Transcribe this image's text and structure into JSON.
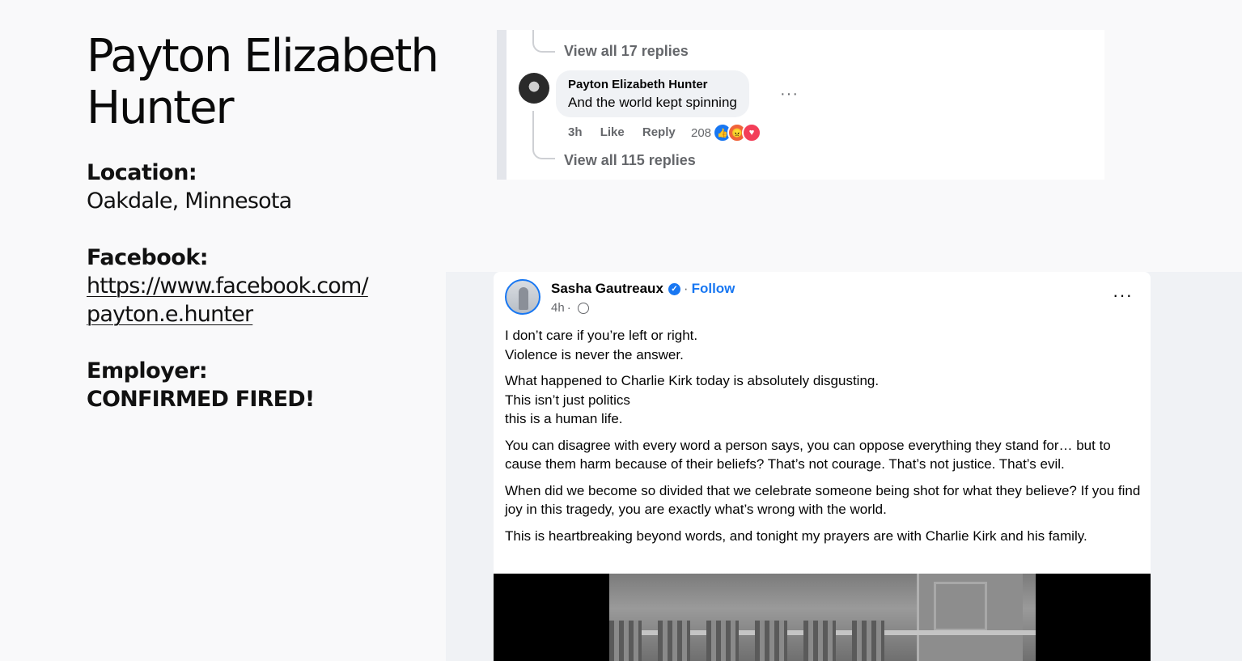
{
  "profile": {
    "name_line1": "Payton Elizabeth",
    "name_line2": "Hunter",
    "location_label": "Location:",
    "location_value": "Oakdale, Minnesota",
    "facebook_label": "Facebook:",
    "facebook_line1": "https://www.facebook.com/",
    "facebook_line2": "payton.e.hunter",
    "employer_label": "Employer:",
    "employer_value": "CONFIRMED FIRED!"
  },
  "comment": {
    "view_replies_top": "View all 17 replies",
    "author": "Payton Elizabeth Hunter",
    "text": "And the world kept spinning",
    "more": "···",
    "time": "3h",
    "like": "Like",
    "reply": "Reply",
    "reaction_count": "208",
    "reactions": [
      "like-icon",
      "angry-icon",
      "love-icon"
    ],
    "view_replies_bottom": "View all 115 replies"
  },
  "post": {
    "author": "Sasha Gautreaux",
    "verified": "✓",
    "separator": "·",
    "follow": "Follow",
    "time": "4h",
    "meta_sep": "·",
    "more": "···",
    "paragraphs": [
      "I don’t care if you’re left or right.\nViolence is never the answer.",
      "What happened to Charlie Kirk today is absolutely disgusting.\nThis isn’t just politics\nthis is a human life.",
      "You can disagree with every word a person says, you can oppose everything they stand for… but to cause them harm because of their beliefs? That’s not courage. That’s not justice. That’s evil.",
      "When did we become so divided that we celebrate someone being shot for what they believe? If you find joy in this tragedy, you are exactly what’s wrong with the world.",
      "This is heartbreaking beyond words, and tonight my prayers are with Charlie Kirk and his family."
    ]
  },
  "colors": {
    "facebook_blue": "#1877f2",
    "secondary_text": "#65676b",
    "bubble_bg": "#f0f2f5"
  }
}
